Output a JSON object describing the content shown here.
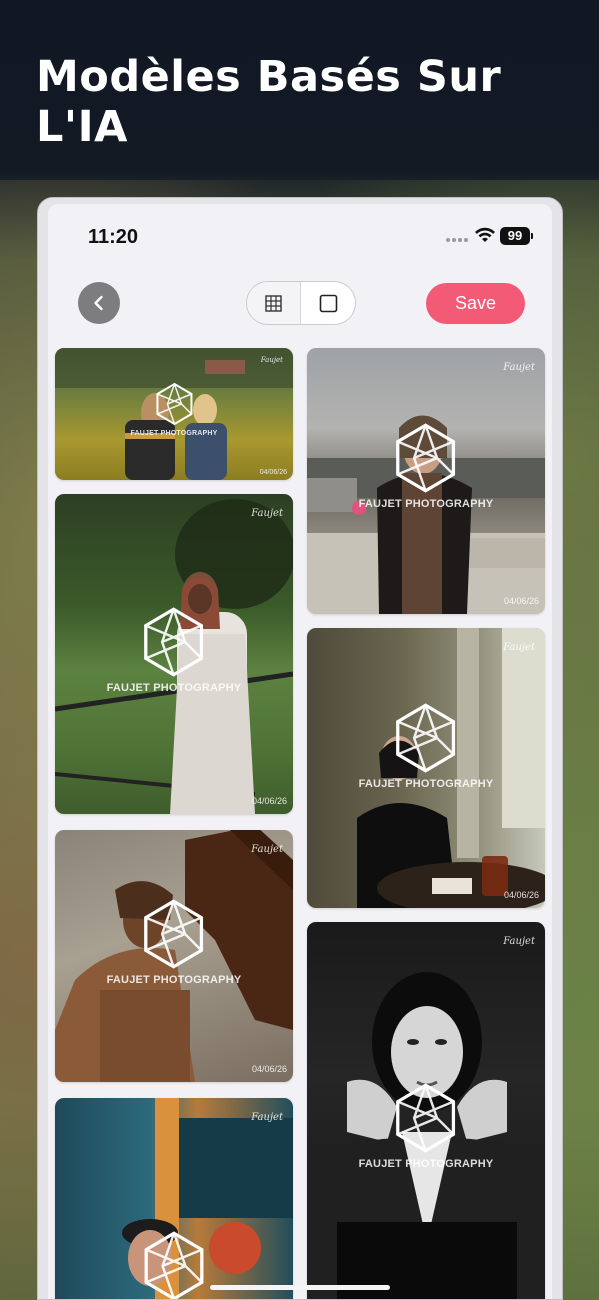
{
  "headline": "Modèles Basés Sur L'IA",
  "status_bar": {
    "time": "11:20",
    "battery": "99"
  },
  "toolbar": {
    "save_label": "Save",
    "back_icon": "chevron-left-icon",
    "grid_icon": "grid-icon",
    "single_icon": "square-icon",
    "selected_view": "single"
  },
  "photos": [
    {
      "watermark": "FAUJET PHOTOGRAPHY",
      "date": "04/06/26",
      "signature": "Faujet"
    },
    {
      "watermark": "FAUJET PHOTOGRAPHY",
      "date": "04/06/26",
      "signature": "Faujet"
    },
    {
      "watermark": "FAUJET PHOTOGRAPHY",
      "date": "04/06/26",
      "signature": "Faujet"
    },
    {
      "watermark": "FAUJET PHOTOGRAPHY",
      "date": "04/06/26",
      "signature": "Faujet"
    },
    {
      "watermark": "FAUJET PHOTOGRAPHY",
      "date": "04/06/26",
      "signature": "Faujet"
    },
    {
      "watermark": "FAUJET PHOTOGRAPHY",
      "date": "",
      "signature": "Faujet"
    },
    {
      "watermark": "FAUJET PHOTOGRAPHY",
      "date": "",
      "signature": "Faujet"
    }
  ],
  "colors": {
    "save": "#f25a76",
    "back": "#7d7d80",
    "background": "#111723"
  }
}
